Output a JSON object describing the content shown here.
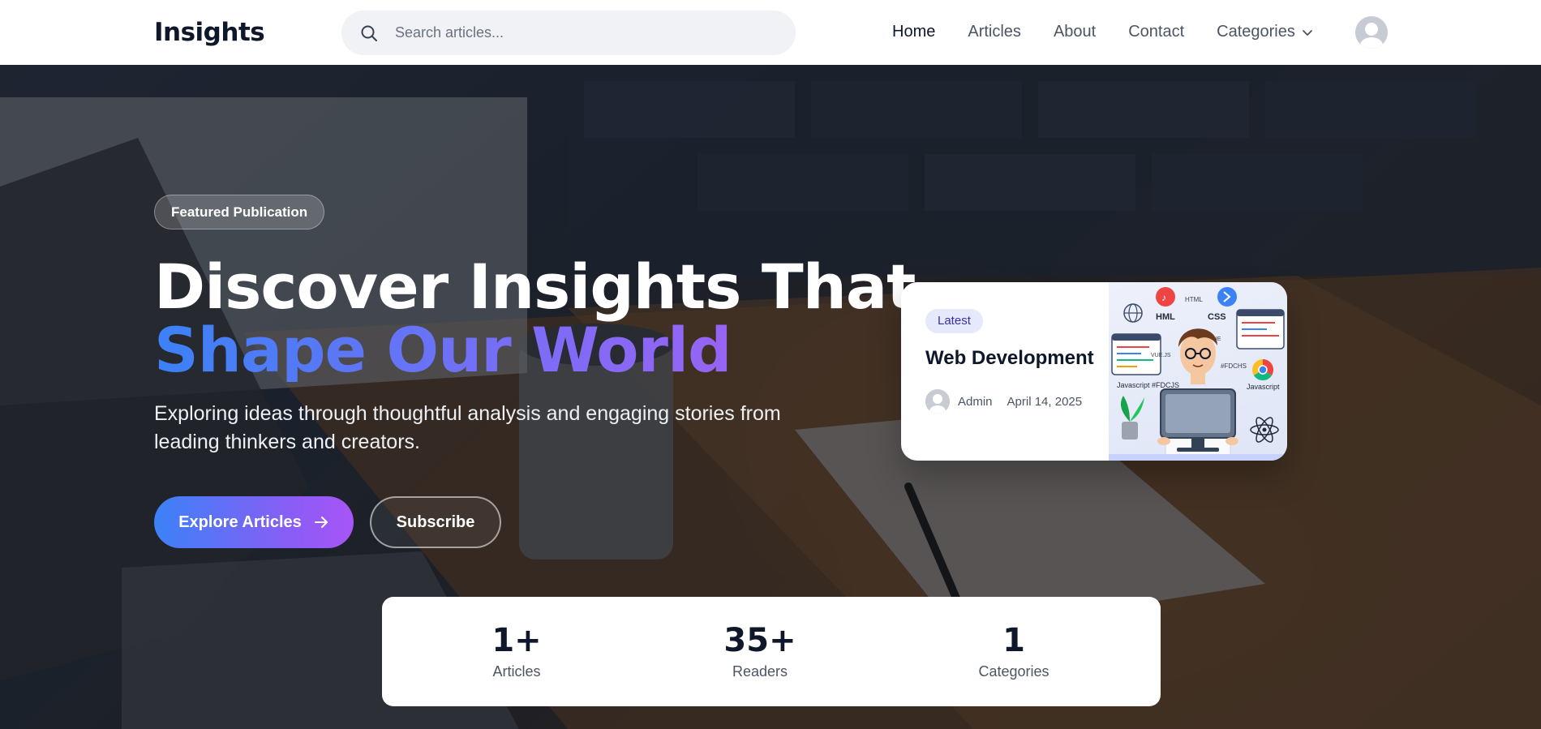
{
  "header": {
    "logo": "Insights",
    "search": {
      "placeholder": "Search articles..."
    },
    "nav": [
      {
        "label": "Home",
        "active": true
      },
      {
        "label": "Articles"
      },
      {
        "label": "About"
      },
      {
        "label": "Contact"
      },
      {
        "label": "Categories",
        "icon": "chevron-down-icon"
      }
    ],
    "avatar_icon": "user-avatar-icon"
  },
  "hero": {
    "badge": "Featured Publication",
    "headline_line1": "Discover Insights That",
    "headline_line2": "Shape Our World",
    "subtitle": "Exploring ideas through thoughtful analysis and engaging stories from leading thinkers and creators.",
    "primary_button": "Explore Articles",
    "primary_button_icon": "arrow-right-icon",
    "secondary_button": "Subscribe"
  },
  "featured_card": {
    "tag": "Latest",
    "title": "Web Development",
    "author": "Admin",
    "date": "April 14, 2025",
    "image_labels": [
      "HML",
      "CSS",
      "HTML",
      "VUE",
      "VUE.JS",
      "Javascript #FDCJS",
      "#FDCHS",
      "Javascript"
    ]
  },
  "stats": [
    {
      "value": "1+",
      "label": "Articles"
    },
    {
      "value": "35+",
      "label": "Readers"
    },
    {
      "value": "1",
      "label": "Categories"
    }
  ],
  "colors": {
    "gradient_start": "#3b82f6",
    "gradient_end": "#a855f7",
    "text_dark": "#0f172a",
    "nav_text": "#4b5563"
  }
}
